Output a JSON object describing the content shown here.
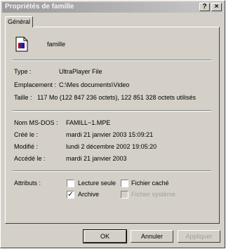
{
  "window": {
    "title": "Propriétés de famille",
    "help_button": "?",
    "close_button": "×"
  },
  "tabs": [
    {
      "label": "Général"
    }
  ],
  "file": {
    "icon": "file-icon",
    "name": "famille"
  },
  "info": {
    "type_label": "Type :",
    "type_value": "UltraPlayer File",
    "location_label": "Emplacement :",
    "location_value": "C:\\Mes documents\\Video",
    "size_label": "Taille :",
    "size_value": "117 Mo (122 847 236 octets), 122 851 328 octets utilisés"
  },
  "details": {
    "msdos_label": "Nom MS-DOS :",
    "msdos_value": "FAMILL~1.MPE",
    "created_label": "Créé le :",
    "created_value": "mardi 21 janvier 2003 15:09:21",
    "modified_label": "Modifié :",
    "modified_value": "lundi 2 décembre 2002 19:05:20",
    "accessed_label": "Accédé le :",
    "accessed_value": "mardi 21 janvier 2003"
  },
  "attributes": {
    "label": "Attributs :",
    "readonly": {
      "label": "Lecture seule",
      "checked": false
    },
    "hidden": {
      "label": "Fichier caché",
      "checked": false
    },
    "archive": {
      "label": "Archive",
      "checked": true
    },
    "system": {
      "label": "Fichier système",
      "checked": false,
      "disabled": true
    }
  },
  "buttons": {
    "ok": "OK",
    "cancel": "Annuler",
    "apply": "Appliquer"
  }
}
